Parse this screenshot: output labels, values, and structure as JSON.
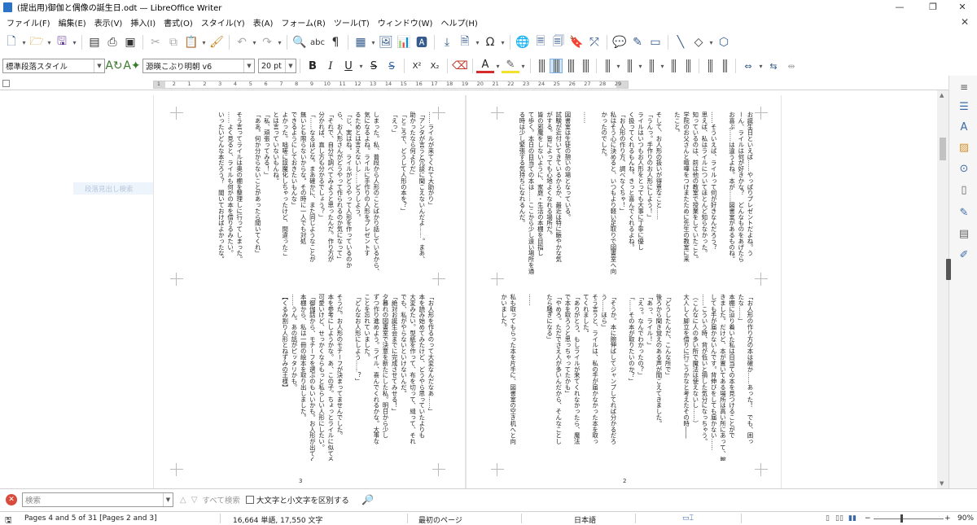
{
  "window": {
    "title": "(提出用)御伽と偶像の誕生日.odt — LibreOffice Writer",
    "minimize": "—",
    "maximize": "❐",
    "close": "✕"
  },
  "menu": {
    "items": [
      "ファイル(F)",
      "編集(E)",
      "表示(V)",
      "挿入(I)",
      "書式(O)",
      "スタイル(Y)",
      "表(A)",
      "フォーム(R)",
      "ツール(T)",
      "ウィンドウ(W)",
      "ヘルプ(H)"
    ],
    "close_doc": "✕"
  },
  "toolbar": {
    "paragraph_style": "標準段落スタイル",
    "font_name": "源暎こぶり明朝 v6",
    "font_size": "20 pt",
    "bold": "B",
    "italic": "I",
    "underline": "U",
    "strikethrough": "S",
    "superscript": "X²",
    "subscript": "X₂"
  },
  "ruler": {
    "labels": [
      "1",
      "2",
      "1",
      "2",
      "3",
      "4",
      "5",
      "6",
      "7",
      "8",
      "9",
      "10",
      "11",
      "12",
      "13",
      "14",
      "15",
      "16",
      "17",
      "18",
      "19",
      "20",
      "21",
      "22",
      "23",
      "24",
      "25",
      "26",
      "27",
      "28",
      "29"
    ]
  },
  "document": {
    "find_ghost": "段落見出し検索",
    "left_page": {
      "page_number": "3",
      "upper_text": "……ライルが来てくれて大助かり」\n「アンタが言うと冗談に聞こえないんだよ……。まあ、\n助かったなら何よりだ」\n「ところで、どうして人形の本を？」\n「えっ」\n\nしまった。私、普段から人形のことばかり話しているから、\n気になるよね。ライルに手作りの人形をプレゼントす\nるためとは言えないし……どうしよう。\n「じ、実はね。ライルがどうやって人形を作っているのか\nら、お人形さんがどうやって作られるのか気になって」\n「それで、自分で調べてみようと思ったんだ。作り方が\n分かれば、直し方も分かるでしょう？」\n「……なるほどな。まあ確かに、また同じようなことが\n無いとも限らないからな。その時に一人でも対処\nできるようにしておきたいもんな」\nよかった。咄嗟に誤魔化しちゃったけど、間違ったこ\nとは言っていないもんね。\n「私、頑張ってみる！」\n「ああ。何か分からないことがあったら聞いてくれ」\n\nそう言ってライルは奥の棚を整理しに行ってしまった。\n……よく見ると、ライルも何かの本を借りるみたい。\nいったいどんな本だろう？　聞いておけばよかったな。",
      "lower_text": "「お人形を作るのって大変なんだなあ……」\n本を読み始めてみたけど、どうやら思っていたよりも\n大変みたい。型紙を作って、布を切って、縫って、それ\nでも、私がやらないといけないんだ。\n「絶対お誕生会までに完成させてみせる！」\n夕暮れの図書室で決意を新たにした私。明日から少し\nずつ作り進めよう。ライル、喜んでくれるかな。大事な\nことを忘れていました。\n「どんなお人形にしよう……？」\n\nそうだ。お人形のモチーフが決まってませんでした。\n本を参考にしようかな。あ、この子。ちょっとライルに似てる……\n可愛いけど、せっかくならもっと私らしい人形にしたい。\n「御伽話から、モチーフを選ぶのもいいかも。お人形が出てくる物語\n本棚から、私は一冊の絵本を取り出しました。\n……うん。あの話がピッタリかも。\n【くるみ割り人形とねずみの王様】"
    },
    "right_page": {
      "page_number": "2",
      "upper_text": "お誕生日といえば……やっぱりプレゼントだよね。う\nーん、ライルは何が好きかな？　どんなものをあげたら\nお喜ぶ……は違うよね。本が……図書室があるものね。\n\n……そういえば、ライルって何が好きなんだろう？\n思えば、私はライルについてほとんど知らなかった。\n知っているのは、前は他の教室で授業をしていたこと。\n学院のお父さんと喧嘩をつけまたために先生の教室に来\nたこと。\n\nそして、お人形の扱いが得意なこと……\n「うんっ。手作りのお人形にしよう！」\nライルはいつもお人形をとっても大事に丁寧に優し\nく扱ってくれるもんね。きっと喜んでくれるよね。\n「お人形の作り方、調べなくちゃ！」\n私はそう心に決めると、いつもより軽い足取りで図書室へ向\nかったのでした。\n\n……\n\n図書室は生徒の憩いの場となっている。\n試験が近付いてきているからか、最近は特に賑やかな気\nがする。皆によっても心地よくなれる場所だ。\n皆の邪魔をしないように、家庭・生活の本棚を目指し\nて歩く。本日の目当ての本は……ここから少し遠い場所を通\nる時は少し緊張する気持ちになれるんだ。",
      "lower_text": "「お人形の作り方の本は確か……あった！　でも、困っ\nたな……」\n本棚に辿り着いた私は目当ての本を見つけることがで\nきました。だけど、本が置いてある場所は高い所にあって、腕を伸ば\nしても手が届かないんです。背伸びをしても届かない……\n……こういう時、背が低いと損した気分になっちゃう。\n（こんなに人の多い所で魔法は使えないし……）\n大人しく脚立を借りに行こうかなと考えたその時――\n\n「どうしたんだ、こんな所で」\n後ろから聞き覚えのある声が聞こえてきました。\n「あっ、ライル！」\n「えっ。なんでわかったの？」\n「……その本が取りたいのか？」\n\n「そうか。本に腕伸ばしてジャンプしてれば分かるだろ\nう……ほら」\nそう言うと、ライルは、私の手が届かなかった本を取っ\nてくれました。\n「ありがとう。もしライルが来てくれなかったら、魔法\nで本を取ろうと思っちゃってたかも」\n「やめろ。ただでさえ人が多いんだから、そんなことし\nたら騒ぎになる」\n\n……\n\n私も取ってもらった本を片手に、図書室の空き机へと向\nかいました。"
    }
  },
  "find": {
    "placeholder": "検索",
    "find_all": "すべて検索",
    "match_case": "大文字と小文字を区別する"
  },
  "status": {
    "page_info": "Pages 4 and 5 of 31 [Pages 2 and 3]",
    "word_count": "16,664 単語, 17,550 文字",
    "page_style": "最初のページ",
    "language": "日本語",
    "zoom": "90%"
  }
}
